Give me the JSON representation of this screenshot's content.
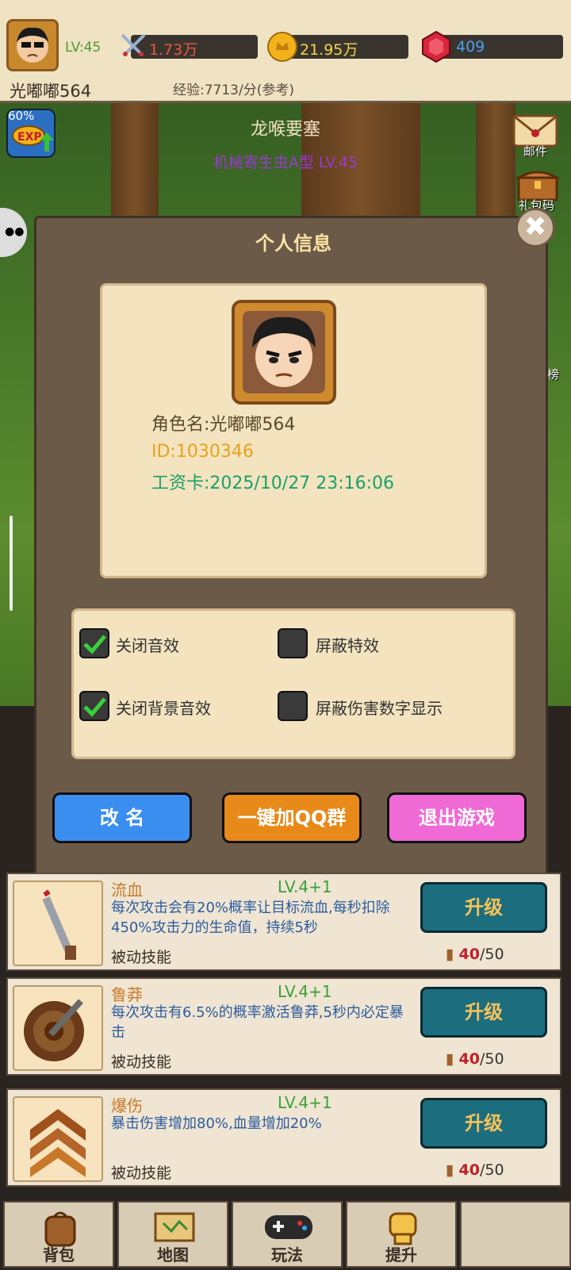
{
  "topbar": {
    "level": "LV:45",
    "power": "1.73万",
    "gold": "21.95万",
    "gems": "409",
    "player_name": "光嘟嘟564",
    "exp_rate": "经验:7713/分(参考)"
  },
  "hud": {
    "exp_percent": "60%",
    "zone_name": "龙喉要塞",
    "monster": "机械寄生虫A型 LV.45",
    "mail_label": "邮件",
    "gift_label": "礼包码",
    "rank_label": "榜"
  },
  "modal": {
    "title": "个人信息",
    "role_name": "角色名:光嘟嘟564",
    "id": "ID:1030346",
    "salary_card": "工资卡:2025/10/27 23:16:06",
    "settings": [
      {
        "label": "关闭音效",
        "checked": true
      },
      {
        "label": "屏蔽特效",
        "checked": false
      },
      {
        "label": "关闭背景音效",
        "checked": true
      },
      {
        "label": "屏蔽伤害数字显示",
        "checked": false
      }
    ],
    "rename_label": "改 名",
    "qq_label": "一键加QQ群",
    "exit_label": "退出游戏"
  },
  "skills": [
    {
      "name": "流血",
      "level": "LV.4+1",
      "desc": "每次攻击会有20%概率让目标流血,每秒扣除450%攻击力的生命值，持续5秒",
      "type": "被动技能",
      "upgrade": "升级",
      "cost_have": "40",
      "cost_total": "/50"
    },
    {
      "name": "鲁莽",
      "level": "LV.4+1",
      "desc": "每次攻击有6.5%的概率激活鲁莽,5秒内必定暴击",
      "type": "被动技能",
      "upgrade": "升级",
      "cost_have": "40",
      "cost_total": "/50"
    },
    {
      "name": "爆伤",
      "level": "LV.4+1",
      "desc": "暴击伤害增加80%,血量增加20%",
      "type": "被动技能",
      "upgrade": "升级",
      "cost_have": "40",
      "cost_total": "/50"
    }
  ],
  "nav": {
    "bag": "背包",
    "map": "地图",
    "play": "玩法",
    "boost": "提升"
  },
  "colors": {
    "parchment": "#f3e3bf",
    "modal_bg": "#6c5a48",
    "rename_btn": "#3a8ef0",
    "qq_btn": "#e88a1a",
    "exit_btn": "#f06ad6",
    "upgrade_btn": "#1c6d7e"
  }
}
